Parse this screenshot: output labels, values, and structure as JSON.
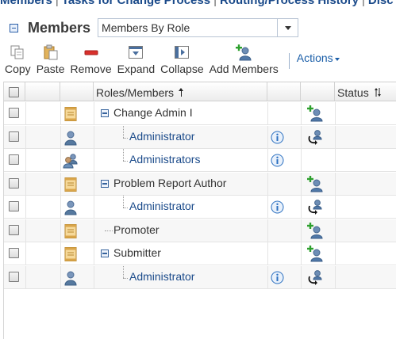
{
  "top_tabs": {
    "members": "Members",
    "sep1": "|",
    "tasks": "Tasks for Change Process",
    "sep2": "|",
    "routing": "Routing/Process History",
    "sep3": "|",
    "disc": "Disc"
  },
  "section": {
    "title": "Members",
    "view_select": "Members By Role"
  },
  "toolbar": {
    "copy": "Copy",
    "paste": "Paste",
    "remove": "Remove",
    "expand": "Expand",
    "collapse": "Collapse",
    "add_members": "Add Members",
    "actions": "Actions"
  },
  "grid": {
    "col_roles": "Roles/Members",
    "col_status": "Status",
    "rows": [
      {
        "name": "Change Admin I",
        "kind": "role"
      },
      {
        "name": "Administrator",
        "kind": "user"
      },
      {
        "name": "Administrators",
        "kind": "group"
      },
      {
        "name": "Problem Report Author",
        "kind": "role"
      },
      {
        "name": "Administrator",
        "kind": "user"
      },
      {
        "name": "Promoter",
        "kind": "role"
      },
      {
        "name": "Submitter",
        "kind": "role"
      },
      {
        "name": "Administrator",
        "kind": "user"
      }
    ]
  },
  "icons": {
    "role": "role-document-icon",
    "user": "user-icon",
    "group": "group-icon",
    "info": "info-icon",
    "add_member": "add-member-icon",
    "replace_member": "replace-member-icon"
  },
  "colors": {
    "link": "#1a4a8a",
    "accent": "#1a5ea8",
    "info": "#2a6fc0",
    "add_green": "#2ea02e"
  }
}
